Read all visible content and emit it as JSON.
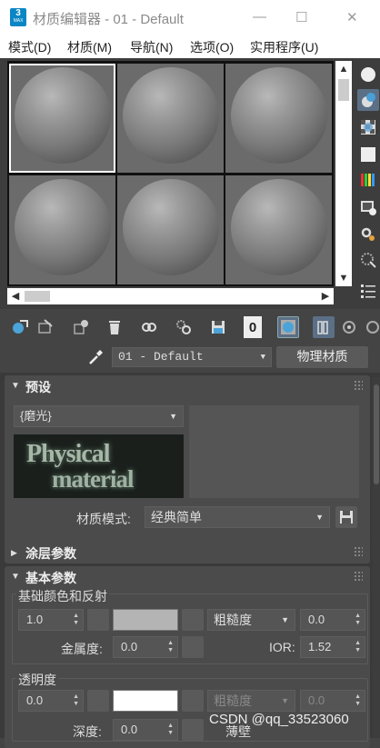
{
  "window": {
    "title": "材质编辑器 - 01 - Default",
    "icon_text": "3",
    "icon_sub": "MAX",
    "minimize": "—",
    "maximize": "☐",
    "close": "✕"
  },
  "menu": [
    "模式(D)",
    "材质(M)",
    "导航(N)",
    "选项(O)",
    "实用程序(U)"
  ],
  "material_name": "01 - Default",
  "material_type": "物理材质",
  "presets": {
    "title": "预设",
    "preset_value": "{磨光}",
    "logo_line1": "Physical",
    "logo_line2": "material",
    "mode_label": "材质模式:",
    "mode_value": "经典简单"
  },
  "coating": {
    "title": "涂层参数"
  },
  "basic": {
    "title": "基本参数",
    "base_group": "基础颜色和反射",
    "base_weight": "1.0",
    "base_color": "#b4b4b4",
    "roughness_mode": "粗糙度",
    "roughness_value": "0.0",
    "metalness_label": "金属度:",
    "metalness_value": "0.0",
    "ior_label": "IOR:",
    "ior_value": "1.52",
    "transparency_group": "透明度",
    "transp_weight": "0.0",
    "transp_color": "#ffffff",
    "transp_roughness_mode": "粗糙度",
    "transp_roughness_value": "0.0",
    "depth_label": "深度:",
    "depth_value": "0.0",
    "thin_label": "薄壁"
  },
  "watermark": "CSDN @qq_33523060"
}
